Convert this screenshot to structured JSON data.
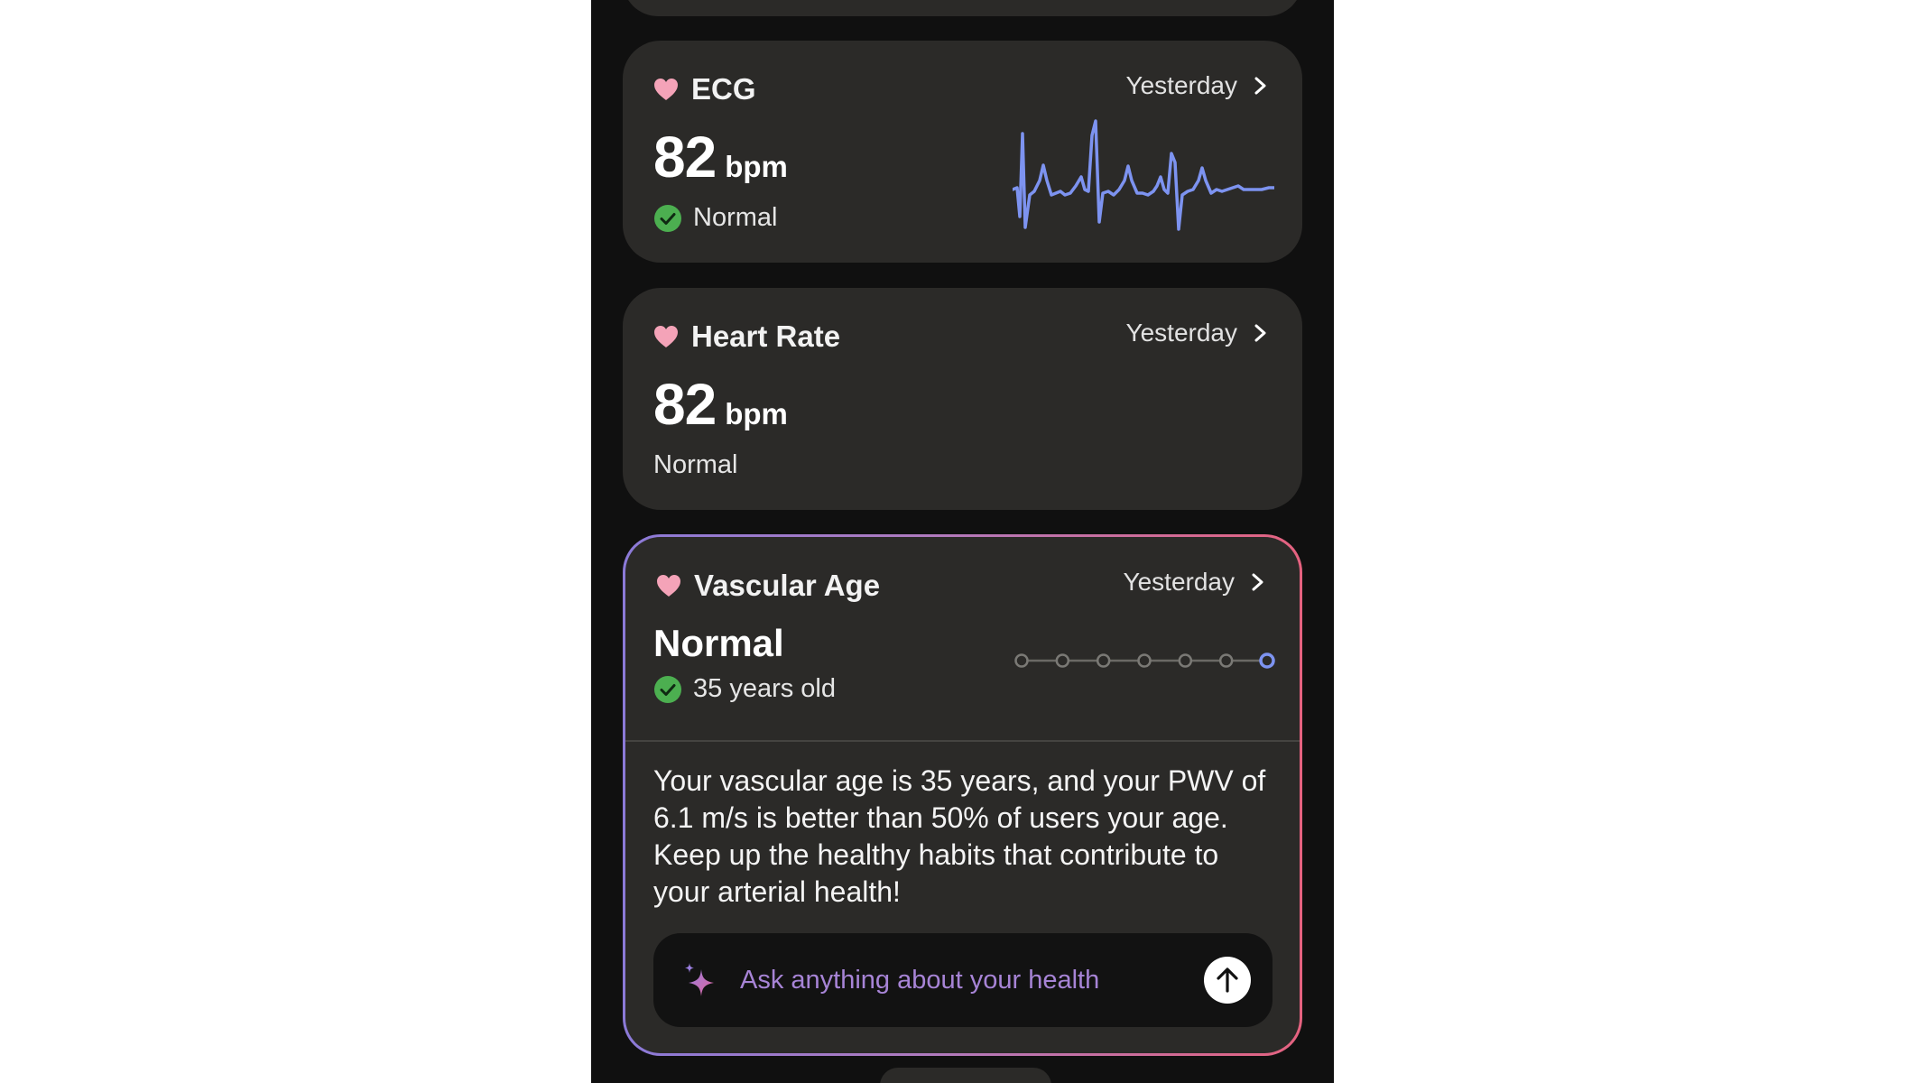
{
  "cards": {
    "ecg": {
      "title": "ECG",
      "date": "Yesterday",
      "value": "82",
      "unit": "bpm",
      "status": "Normal"
    },
    "heart_rate": {
      "title": "Heart Rate",
      "date": "Yesterday",
      "value": "82",
      "unit": "bpm",
      "status": "Normal"
    },
    "vascular_age": {
      "title": "Vascular Age",
      "date": "Yesterday",
      "value": "Normal",
      "status": "35 years old",
      "scale_steps": 7,
      "scale_selected": 7,
      "insight": "Your vascular age is 35 years, and your PWV of 6.1 m/s is better than 50% of users your age. Keep up the healthy habits that contribute to your arterial health!",
      "ask_placeholder": "Ask anything about your health"
    }
  },
  "colors": {
    "background": "#101010",
    "card": "#2b2a28",
    "heart": "#f4a3b8",
    "check": "#4caf50",
    "accent": "#7d93f0",
    "border_start": "#8b7ad8",
    "border_end": "#e5627f"
  },
  "icons": {
    "heart": "heart-icon",
    "chevron": "chevron-right-icon",
    "check": "check-circle-icon",
    "sparkle": "sparkle-icon",
    "send": "arrow-up-icon"
  }
}
